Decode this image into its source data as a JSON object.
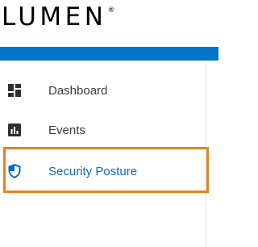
{
  "brand": {
    "logo_text": "LUMEN",
    "registered_mark": "®"
  },
  "colors": {
    "accent_blue": "#0075c9",
    "active_text": "#0a6bc2",
    "highlight_orange": "#e98125",
    "icon_dark": "#2f2f2f"
  },
  "sidebar": {
    "items": [
      {
        "label": "Dashboard",
        "icon": "dashboard-icon",
        "active": false
      },
      {
        "label": "Events",
        "icon": "bar-chart-icon",
        "active": false
      },
      {
        "label": "Security Posture",
        "icon": "shield-icon",
        "active": true
      }
    ]
  }
}
